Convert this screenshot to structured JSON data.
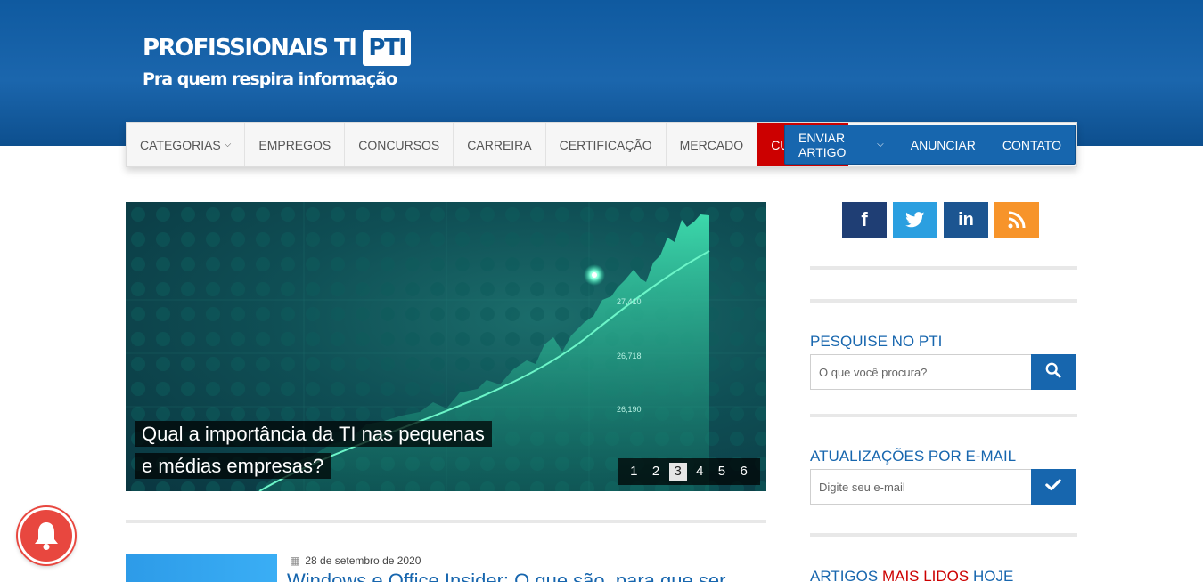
{
  "header": {
    "logo_text": "PROFISSIONAIS TI",
    "logo_badge": "PTI",
    "tagline": "Pra quem respira informação",
    "bg_color": "#1766ae"
  },
  "nav": {
    "items": [
      {
        "label": "CATEGORIAS",
        "has_dropdown": true
      },
      {
        "label": "EMPREGOS"
      },
      {
        "label": "CONCURSOS"
      },
      {
        "label": "CARREIRA"
      },
      {
        "label": "CERTIFICAÇÃO"
      },
      {
        "label": "MERCADO"
      },
      {
        "label": "CURSOS",
        "has_dropdown": true,
        "highlight_color": "#cc0000"
      }
    ],
    "right_items": [
      {
        "label": "ENVIAR ARTIGO",
        "has_dropdown": true
      },
      {
        "label": "ANUNCIAR"
      },
      {
        "label": "CONTATO"
      }
    ]
  },
  "slider": {
    "caption": "Qual a importância da TI nas pequenas e médias empresas?",
    "chart_labels": [
      "27,410",
      "26,718",
      "26,190"
    ],
    "pages": [
      "1",
      "2",
      "3",
      "4",
      "5",
      "6"
    ],
    "active_page": "3"
  },
  "social": {
    "items": [
      {
        "name": "facebook-icon",
        "glyph": "f",
        "color": "#1f3e74"
      },
      {
        "name": "twitter-icon",
        "glyph": "🐦",
        "color": "#2b9fe0"
      },
      {
        "name": "linkedin-icon",
        "glyph": "in",
        "color": "#1c5591"
      },
      {
        "name": "rss-icon",
        "glyph": "rss",
        "color": "#f7942a"
      }
    ]
  },
  "search_widget": {
    "title": "PESQUISE NO PTI",
    "placeholder": "O que você procura?"
  },
  "email_widget": {
    "title": "ATUALIZAÇÕES POR E-MAIL",
    "placeholder": "Digite seu e-mail"
  },
  "popular_widget": {
    "title_part1": "ARTIGOS",
    "title_part2": "MAIS LIDOS",
    "title_part3": "HOJE"
  },
  "post": {
    "date": "28 de setembro de 2020",
    "title": "Windows e Office Insider: O que são, para que ser..."
  }
}
